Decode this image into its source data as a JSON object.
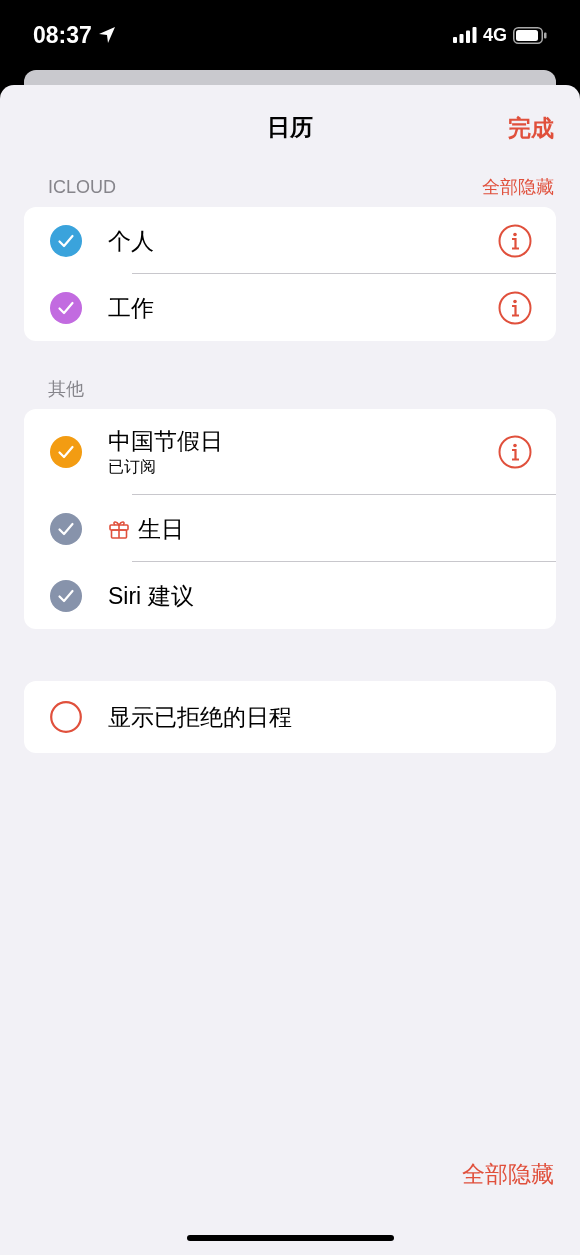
{
  "status_bar": {
    "time": "08:37",
    "network": "4G"
  },
  "title": "日历",
  "done": "完成",
  "sections": [
    {
      "header": "ICLOUD",
      "action": "全部隐藏",
      "calendars": [
        {
          "name": "个人",
          "kind": "calendar",
          "checked": true,
          "color": "#3aa3dc",
          "has_info": true
        },
        {
          "name": "工作",
          "kind": "calendar",
          "checked": true,
          "color": "#c26be0",
          "has_info": true
        }
      ]
    },
    {
      "header": "其他",
      "calendars": [
        {
          "name": "中国节假日",
          "subtitle": "已订阅",
          "kind": "calendar",
          "checked": true,
          "color": "#f39c12",
          "has_info": true
        },
        {
          "name": "生日",
          "kind": "birthday",
          "checked": true,
          "color": "#8793ab",
          "has_info": false
        },
        {
          "name": "Siri 建议",
          "kind": "calendar",
          "checked": true,
          "color": "#8793ab",
          "has_info": false
        }
      ]
    }
  ],
  "declined": {
    "label": "显示已拒绝的日程",
    "checked": false
  },
  "bottom_action": "全部隐藏"
}
